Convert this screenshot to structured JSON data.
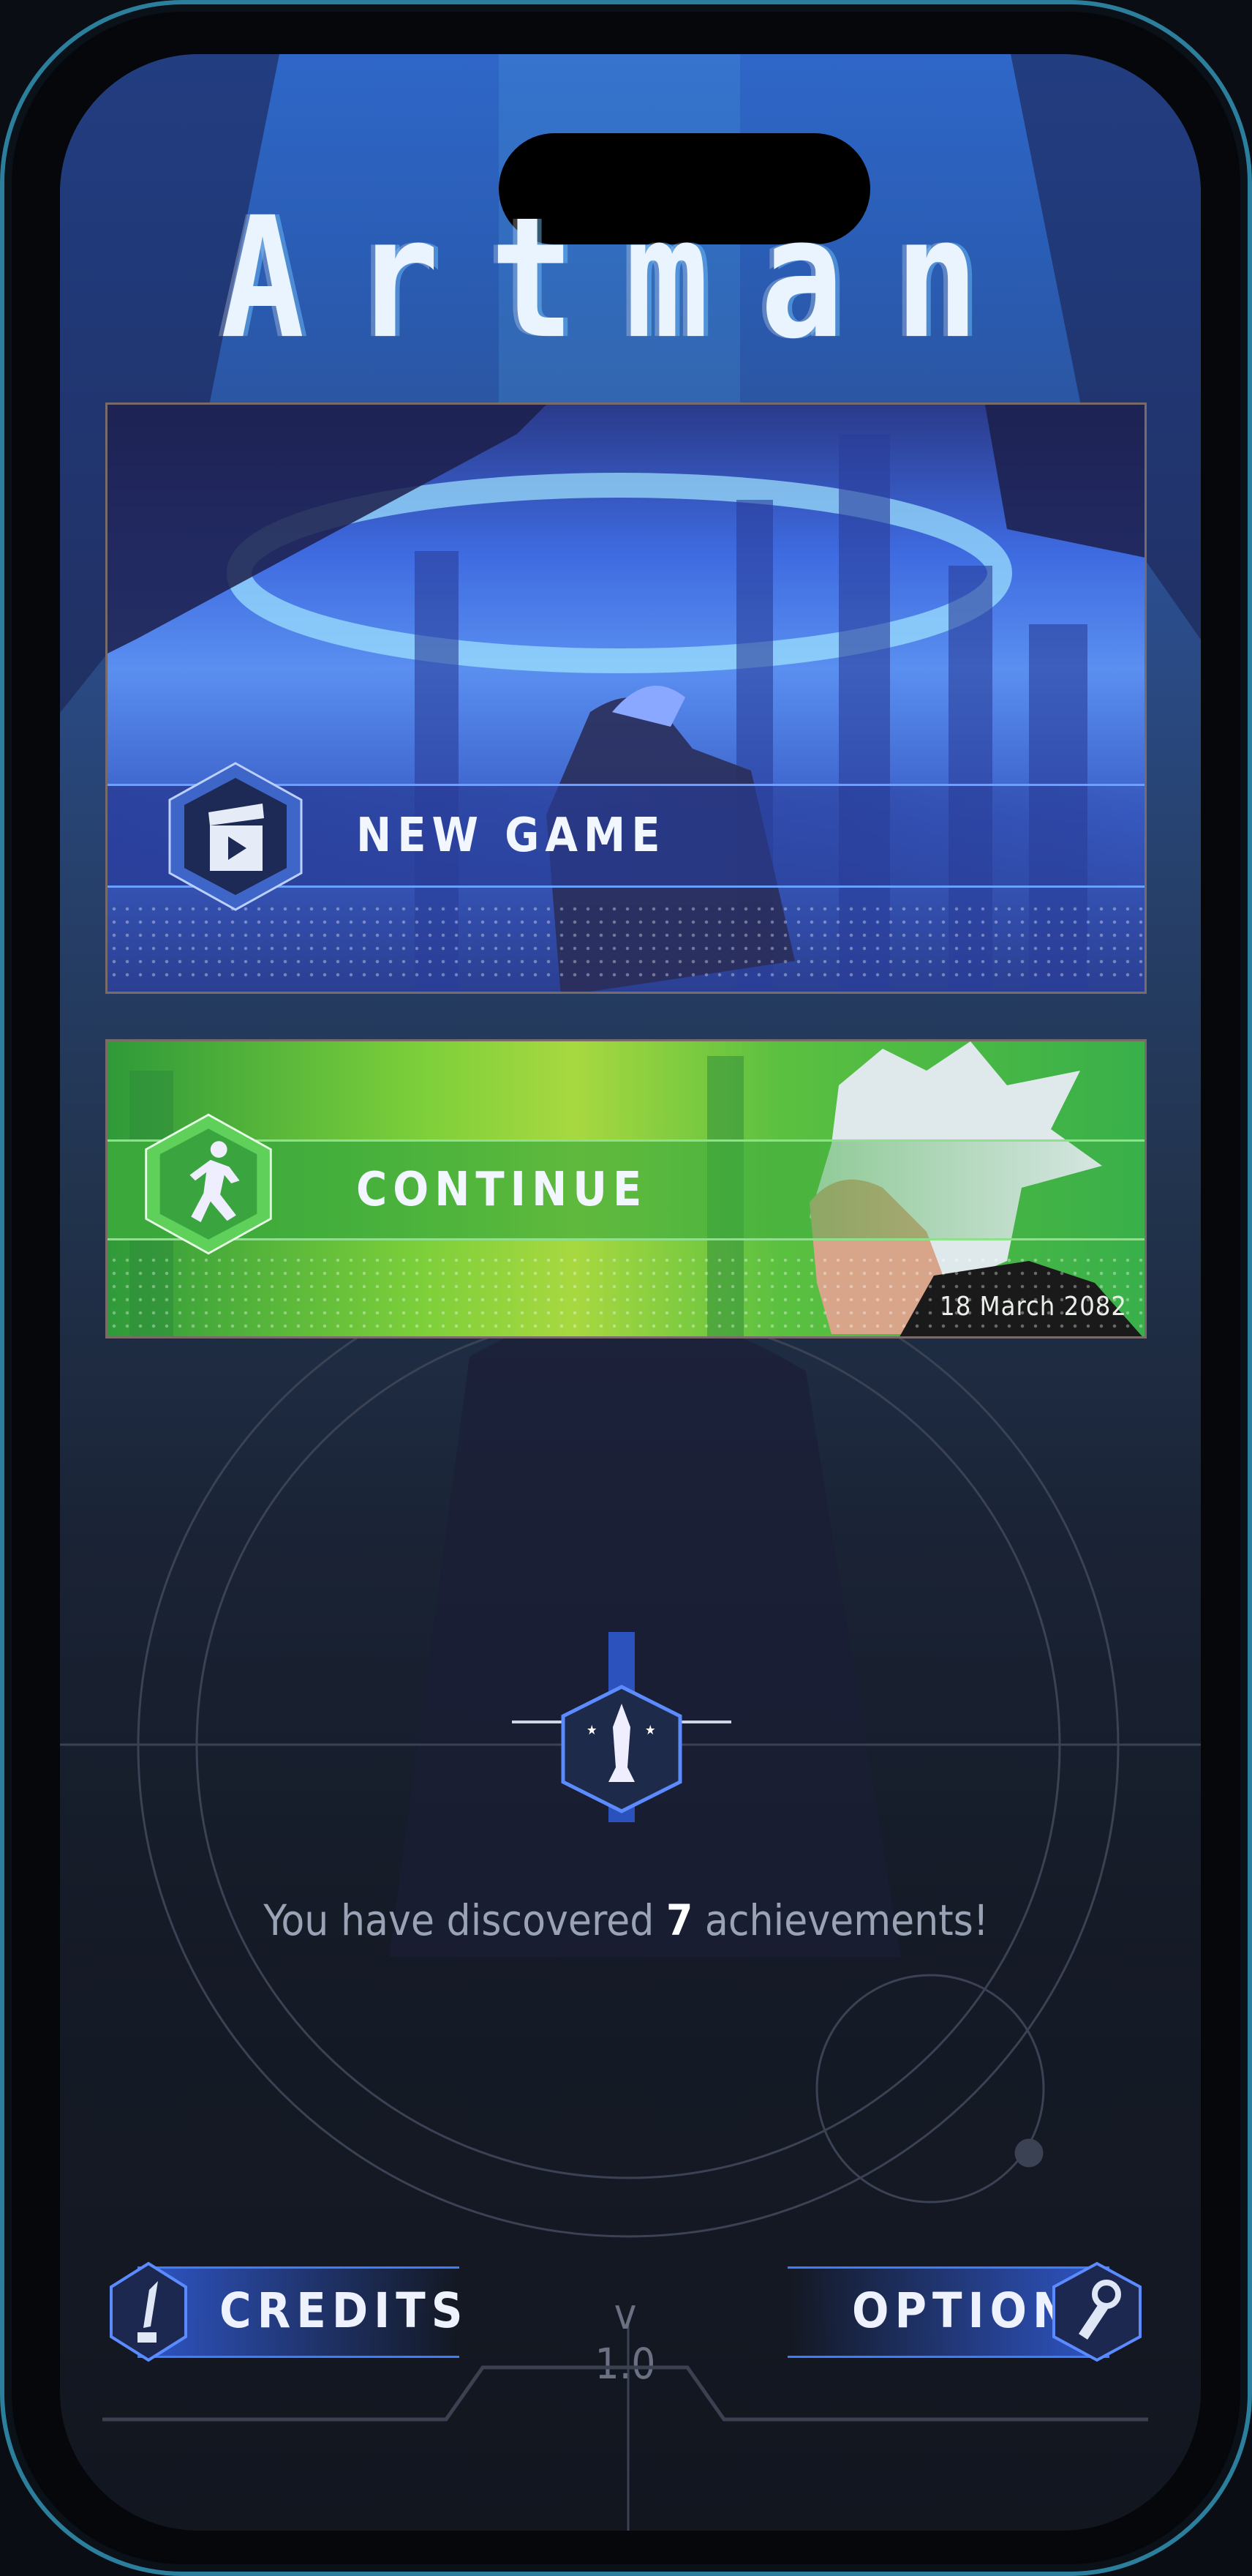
{
  "app": {
    "title": "Artman"
  },
  "menu": {
    "new_game": {
      "label": "NEW GAME",
      "icon": "clapperboard-icon",
      "accent": "#3d6ee0"
    },
    "continue": {
      "label": "CONTINUE",
      "icon": "running-man-icon",
      "accent": "#4cc04a",
      "save_date": "18 March 2082"
    }
  },
  "achievements": {
    "prefix": "You have discovered",
    "count": "7",
    "suffix": "achievements!",
    "icon": "trophy-icon"
  },
  "footer": {
    "credits": {
      "label": "CREDITS",
      "icon": "quill-icon"
    },
    "options": {
      "label": "OPTIONS",
      "icon": "wrench-icon"
    },
    "version": "v 1.0"
  },
  "colors": {
    "background": "#12161f",
    "glow": "#3d7bff"
  }
}
